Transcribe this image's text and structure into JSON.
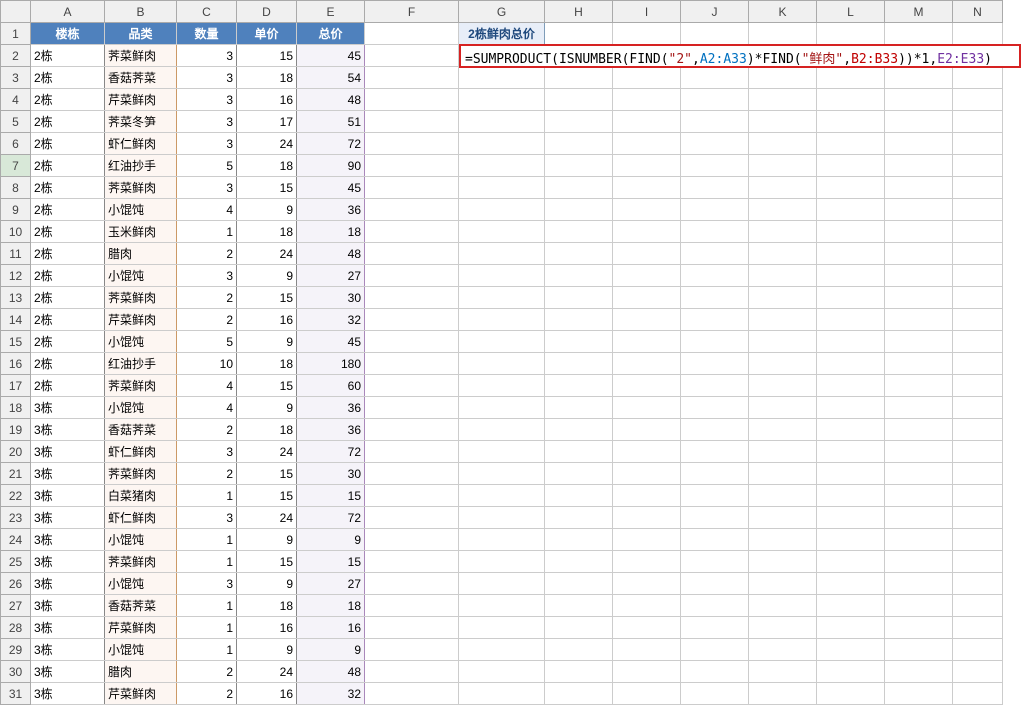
{
  "columns": [
    "A",
    "B",
    "C",
    "D",
    "E",
    "F",
    "G",
    "H",
    "I",
    "J",
    "K",
    "L",
    "M",
    "N"
  ],
  "col_classes": [
    "c-a",
    "c-b",
    "c-c",
    "c-d",
    "c-e",
    "c-f",
    "c-g",
    "c-h",
    "c-i",
    "c-j",
    "c-k",
    "c-l",
    "c-m",
    "c-n"
  ],
  "headers": {
    "a": "楼栋",
    "b": "品类",
    "c": "数量",
    "d": "单价",
    "e": "总价"
  },
  "g1_label": "2栋鲜肉总价",
  "formula": {
    "parts": [
      {
        "t": "=",
        "c": "tok-eq"
      },
      {
        "t": "SUMPRODUCT",
        "c": "tok-fn"
      },
      {
        "t": "(",
        "c": "tok-op"
      },
      {
        "t": "ISNUMBER",
        "c": "tok-fn"
      },
      {
        "t": "(",
        "c": "tok-op"
      },
      {
        "t": "FIND",
        "c": "tok-fn"
      },
      {
        "t": "(",
        "c": "tok-op"
      },
      {
        "t": "\"2\"",
        "c": "tok-str"
      },
      {
        "t": ",",
        "c": "tok-op"
      },
      {
        "t": "A2:A33",
        "c": "tok-r1"
      },
      {
        "t": ")*",
        "c": "tok-op"
      },
      {
        "t": "FIND",
        "c": "tok-fn"
      },
      {
        "t": "(",
        "c": "tok-op"
      },
      {
        "t": "\"鲜肉\"",
        "c": "tok-str"
      },
      {
        "t": ",",
        "c": "tok-op"
      },
      {
        "t": "B2:B33",
        "c": "tok-r2"
      },
      {
        "t": "))*1,",
        "c": "tok-op"
      },
      {
        "t": "E2:E33",
        "c": "tok-r3"
      },
      {
        "t": ")",
        "c": "tok-op"
      }
    ]
  },
  "rows": [
    {
      "r": 2,
      "a": "2栋",
      "b": "荠菜鲜肉",
      "c": 3,
      "d": 15,
      "e": 45
    },
    {
      "r": 3,
      "a": "2栋",
      "b": "香菇荠菜",
      "c": 3,
      "d": 18,
      "e": 54
    },
    {
      "r": 4,
      "a": "2栋",
      "b": "芹菜鲜肉",
      "c": 3,
      "d": 16,
      "e": 48
    },
    {
      "r": 5,
      "a": "2栋",
      "b": "荠菜冬笋",
      "c": 3,
      "d": 17,
      "e": 51
    },
    {
      "r": 6,
      "a": "2栋",
      "b": "虾仁鲜肉",
      "c": 3,
      "d": 24,
      "e": 72
    },
    {
      "r": 7,
      "a": "2栋",
      "b": "红油抄手",
      "c": 5,
      "d": 18,
      "e": 90,
      "sel": true
    },
    {
      "r": 8,
      "a": "2栋",
      "b": "荠菜鲜肉",
      "c": 3,
      "d": 15,
      "e": 45
    },
    {
      "r": 9,
      "a": "2栋",
      "b": "小馄饨",
      "c": 4,
      "d": 9,
      "e": 36
    },
    {
      "r": 10,
      "a": "2栋",
      "b": "玉米鲜肉",
      "c": 1,
      "d": 18,
      "e": 18
    },
    {
      "r": 11,
      "a": "2栋",
      "b": "腊肉",
      "c": 2,
      "d": 24,
      "e": 48
    },
    {
      "r": 12,
      "a": "2栋",
      "b": "小馄饨",
      "c": 3,
      "d": 9,
      "e": 27
    },
    {
      "r": 13,
      "a": "2栋",
      "b": "荠菜鲜肉",
      "c": 2,
      "d": 15,
      "e": 30
    },
    {
      "r": 14,
      "a": "2栋",
      "b": "芹菜鲜肉",
      "c": 2,
      "d": 16,
      "e": 32
    },
    {
      "r": 15,
      "a": "2栋",
      "b": "小馄饨",
      "c": 5,
      "d": 9,
      "e": 45
    },
    {
      "r": 16,
      "a": "2栋",
      "b": "红油抄手",
      "c": 10,
      "d": 18,
      "e": 180
    },
    {
      "r": 17,
      "a": "2栋",
      "b": "荠菜鲜肉",
      "c": 4,
      "d": 15,
      "e": 60
    },
    {
      "r": 18,
      "a": "3栋",
      "b": "小馄饨",
      "c": 4,
      "d": 9,
      "e": 36
    },
    {
      "r": 19,
      "a": "3栋",
      "b": "香菇荠菜",
      "c": 2,
      "d": 18,
      "e": 36
    },
    {
      "r": 20,
      "a": "3栋",
      "b": "虾仁鲜肉",
      "c": 3,
      "d": 24,
      "e": 72
    },
    {
      "r": 21,
      "a": "3栋",
      "b": "荠菜鲜肉",
      "c": 2,
      "d": 15,
      "e": 30
    },
    {
      "r": 22,
      "a": "3栋",
      "b": "白菜猪肉",
      "c": 1,
      "d": 15,
      "e": 15
    },
    {
      "r": 23,
      "a": "3栋",
      "b": "虾仁鲜肉",
      "c": 3,
      "d": 24,
      "e": 72
    },
    {
      "r": 24,
      "a": "3栋",
      "b": "小馄饨",
      "c": 1,
      "d": 9,
      "e": 9
    },
    {
      "r": 25,
      "a": "3栋",
      "b": "荠菜鲜肉",
      "c": 1,
      "d": 15,
      "e": 15
    },
    {
      "r": 26,
      "a": "3栋",
      "b": "小馄饨",
      "c": 3,
      "d": 9,
      "e": 27
    },
    {
      "r": 27,
      "a": "3栋",
      "b": "香菇荠菜",
      "c": 1,
      "d": 18,
      "e": 18
    },
    {
      "r": 28,
      "a": "3栋",
      "b": "芹菜鲜肉",
      "c": 1,
      "d": 16,
      "e": 16
    },
    {
      "r": 29,
      "a": "3栋",
      "b": "小馄饨",
      "c": 1,
      "d": 9,
      "e": 9
    },
    {
      "r": 30,
      "a": "3栋",
      "b": "腊肉",
      "c": 2,
      "d": 24,
      "e": 48
    },
    {
      "r": 31,
      "a": "3栋",
      "b": "芹菜鲜肉",
      "c": 2,
      "d": 16,
      "e": 32
    }
  ]
}
